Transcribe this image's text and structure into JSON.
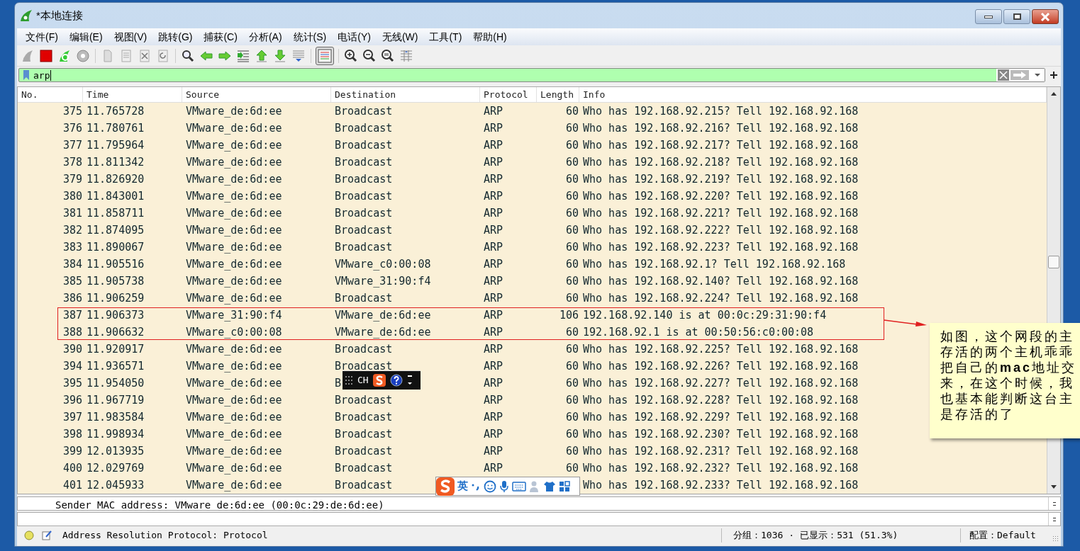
{
  "window": {
    "title": "*本地连接"
  },
  "menu": [
    "文件(F)",
    "编辑(E)",
    "视图(V)",
    "跳转(G)",
    "捕获(C)",
    "分析(A)",
    "统计(S)",
    "电话(Y)",
    "无线(W)",
    "工具(T)",
    "帮助(H)"
  ],
  "filter": {
    "value": "arp"
  },
  "columns": [
    "No.",
    "Time",
    "Source",
    "Destination",
    "Protocol",
    "Length",
    "Info"
  ],
  "rows": [
    {
      "no": "375",
      "time": "11.765728",
      "source": "VMware_de:6d:ee",
      "destination": "Broadcast",
      "protocol": "ARP",
      "length": "60",
      "info": "Who has 192.168.92.215? Tell 192.168.92.168",
      "marked": false
    },
    {
      "no": "376",
      "time": "11.780761",
      "source": "VMware_de:6d:ee",
      "destination": "Broadcast",
      "protocol": "ARP",
      "length": "60",
      "info": "Who has 192.168.92.216? Tell 192.168.92.168",
      "marked": false
    },
    {
      "no": "377",
      "time": "11.795964",
      "source": "VMware_de:6d:ee",
      "destination": "Broadcast",
      "protocol": "ARP",
      "length": "60",
      "info": "Who has 192.168.92.217? Tell 192.168.92.168",
      "marked": false
    },
    {
      "no": "378",
      "time": "11.811342",
      "source": "VMware_de:6d:ee",
      "destination": "Broadcast",
      "protocol": "ARP",
      "length": "60",
      "info": "Who has 192.168.92.218? Tell 192.168.92.168",
      "marked": false
    },
    {
      "no": "379",
      "time": "11.826920",
      "source": "VMware_de:6d:ee",
      "destination": "Broadcast",
      "protocol": "ARP",
      "length": "60",
      "info": "Who has 192.168.92.219? Tell 192.168.92.168",
      "marked": false
    },
    {
      "no": "380",
      "time": "11.843001",
      "source": "VMware_de:6d:ee",
      "destination": "Broadcast",
      "protocol": "ARP",
      "length": "60",
      "info": "Who has 192.168.92.220? Tell 192.168.92.168",
      "marked": false
    },
    {
      "no": "381",
      "time": "11.858711",
      "source": "VMware_de:6d:ee",
      "destination": "Broadcast",
      "protocol": "ARP",
      "length": "60",
      "info": "Who has 192.168.92.221? Tell 192.168.92.168",
      "marked": false
    },
    {
      "no": "382",
      "time": "11.874095",
      "source": "VMware_de:6d:ee",
      "destination": "Broadcast",
      "protocol": "ARP",
      "length": "60",
      "info": "Who has 192.168.92.222? Tell 192.168.92.168",
      "marked": false
    },
    {
      "no": "383",
      "time": "11.890067",
      "source": "VMware_de:6d:ee",
      "destination": "Broadcast",
      "protocol": "ARP",
      "length": "60",
      "info": "Who has 192.168.92.223? Tell 192.168.92.168",
      "marked": false
    },
    {
      "no": "384",
      "time": "11.905516",
      "source": "VMware_de:6d:ee",
      "destination": "VMware_c0:00:08",
      "protocol": "ARP",
      "length": "60",
      "info": "Who has 192.168.92.1? Tell 192.168.92.168",
      "marked": false
    },
    {
      "no": "385",
      "time": "11.905738",
      "source": "VMware_de:6d:ee",
      "destination": "VMware_31:90:f4",
      "protocol": "ARP",
      "length": "60",
      "info": "Who has 192.168.92.140? Tell 192.168.92.168",
      "marked": false
    },
    {
      "no": "386",
      "time": "11.906259",
      "source": "VMware_de:6d:ee",
      "destination": "Broadcast",
      "protocol": "ARP",
      "length": "60",
      "info": "Who has 192.168.92.224? Tell 192.168.92.168",
      "marked": false
    },
    {
      "no": "387",
      "time": "11.906373",
      "source": "VMware_31:90:f4",
      "destination": "VMware_de:6d:ee",
      "protocol": "ARP",
      "length": "106",
      "info": "192.168.92.140 is at 00:0c:29:31:90:f4",
      "marked": true
    },
    {
      "no": "388",
      "time": "11.906632",
      "source": "VMware_c0:00:08",
      "destination": "VMware_de:6d:ee",
      "protocol": "ARP",
      "length": "60",
      "info": "192.168.92.1 is at 00:50:56:c0:00:08",
      "marked": true
    },
    {
      "no": "390",
      "time": "11.920917",
      "source": "VMware_de:6d:ee",
      "destination": "Broadcast",
      "protocol": "ARP",
      "length": "60",
      "info": "Who has 192.168.92.225? Tell 192.168.92.168",
      "marked": false
    },
    {
      "no": "394",
      "time": "11.936571",
      "source": "VMware_de:6d:ee",
      "destination": "Broadcast",
      "protocol": "ARP",
      "length": "60",
      "info": "Who has 192.168.92.226? Tell 192.168.92.168",
      "marked": false
    },
    {
      "no": "395",
      "time": "11.954050",
      "source": "VMware_de:6d:ee",
      "destination": "B",
      "protocol": "ARP",
      "length": "60",
      "info": "Who has 192.168.92.227? Tell 192.168.92.168",
      "marked": false
    },
    {
      "no": "396",
      "time": "11.967719",
      "source": "VMware_de:6d:ee",
      "destination": "Broadcast",
      "protocol": "ARP",
      "length": "60",
      "info": "Who has 192.168.92.228? Tell 192.168.92.168",
      "marked": false
    },
    {
      "no": "397",
      "time": "11.983584",
      "source": "VMware_de:6d:ee",
      "destination": "Broadcast",
      "protocol": "ARP",
      "length": "60",
      "info": "Who has 192.168.92.229? Tell 192.168.92.168",
      "marked": false
    },
    {
      "no": "398",
      "time": "11.998934",
      "source": "VMware_de:6d:ee",
      "destination": "Broadcast",
      "protocol": "ARP",
      "length": "60",
      "info": "Who has 192.168.92.230? Tell 192.168.92.168",
      "marked": false
    },
    {
      "no": "399",
      "time": "12.013935",
      "source": "VMware_de:6d:ee",
      "destination": "Broadcast",
      "protocol": "ARP",
      "length": "60",
      "info": "Who has 192.168.92.231? Tell 192.168.92.168",
      "marked": false
    },
    {
      "no": "400",
      "time": "12.029769",
      "source": "VMware_de:6d:ee",
      "destination": "Broadcast",
      "protocol": "ARP",
      "length": "60",
      "info": "Who has 192.168.92.232? Tell 192.168.92.168",
      "marked": false
    },
    {
      "no": "401",
      "time": "12.045933",
      "source": "VMware_de:6d:ee",
      "destination": "Broadcast",
      "info": "Who has 192.168.92.233? Tell 192.168.92.168",
      "marked": false
    }
  ],
  "detail": {
    "line": "Sender MAC address: VMware_de:6d:ee (00:0c:29:de:6d:ee)"
  },
  "status_bar": {
    "field": "Address Resolution Protocol: Protocol",
    "packets": "分组：1036",
    "separator": "·",
    "displayed": "已显示：531 (51.3%)",
    "profile": "配置：Default"
  },
  "ime_bar": {
    "mode": "CH"
  },
  "ime_toolbar": {
    "mode": "英"
  },
  "callout": {
    "lines": [
      "如图，这个网段的主",
      "存活的两个主机乖乖",
      "把自己的**mac**地址交",
      "来，在这个时候，我",
      "也基本能判断这台主",
      "是存活的了"
    ]
  }
}
